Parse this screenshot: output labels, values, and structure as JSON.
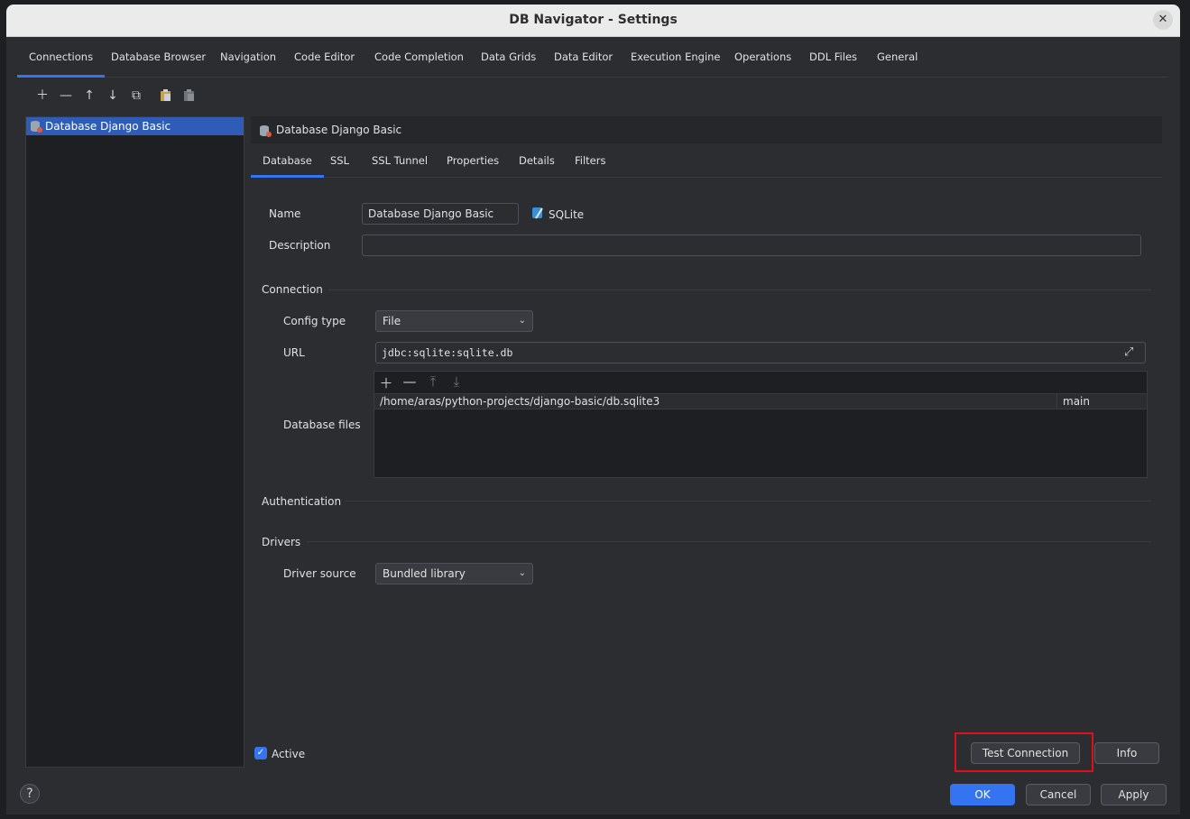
{
  "window": {
    "title": "DB Navigator - Settings",
    "close_glyph": "✕"
  },
  "main_tabs": [
    "Connections",
    "Database Browser",
    "Navigation",
    "Code Editor",
    "Code Completion",
    "Data Grids",
    "Data Editor",
    "Execution Engine",
    "Operations",
    "DDL Files",
    "General"
  ],
  "toolbar": {
    "icons": [
      "add-icon",
      "remove-icon",
      "move-up-icon",
      "move-down-icon",
      "copy-icon",
      "paste-icon",
      "delete-icon"
    ]
  },
  "connections_tree": {
    "items": [
      "Database Django Basic"
    ]
  },
  "connection_header": {
    "label": "Database Django Basic"
  },
  "sub_tabs": [
    "Database",
    "SSL",
    "SSL Tunnel",
    "Properties",
    "Details",
    "Filters"
  ],
  "form": {
    "name_label": "Name",
    "name_value": "Database Django Basic",
    "db_type": "SQLite",
    "description_label": "Description",
    "description_value": "",
    "connection_section": "Connection",
    "config_type_label": "Config type",
    "config_type_value": "File",
    "url_label": "URL",
    "url_value": "jdbc:sqlite:sqlite.db",
    "database_files_label": "Database files",
    "files": [
      {
        "path": "/home/aras/python-projects/django-basic/db.sqlite3",
        "alias": "main"
      }
    ],
    "authentication_section": "Authentication",
    "drivers_section": "Drivers",
    "driver_source_label": "Driver source",
    "driver_source_value": "Bundled library"
  },
  "active_label": "Active",
  "active_checked": true,
  "buttons": {
    "test_connection": "Test Connection",
    "info": "Info",
    "ok": "OK",
    "cancel": "Cancel",
    "apply": "Apply",
    "help": "?"
  },
  "colors": {
    "accent": "#3574f0",
    "highlight": "#e0101a",
    "background": "#2b2d30"
  }
}
